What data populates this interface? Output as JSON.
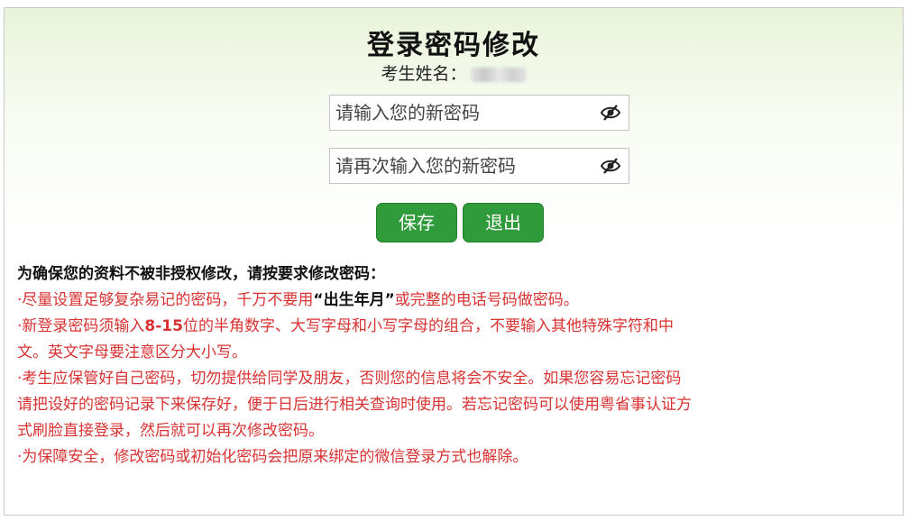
{
  "page": {
    "title": "登录密码修改",
    "name_label": "考生姓名："
  },
  "form": {
    "new_password_placeholder": "请输入您的新密码",
    "confirm_password_placeholder": "请再次输入您的新密码",
    "save_label": "保存",
    "exit_label": "退出"
  },
  "notice": {
    "heading": "为确保您的资料不被非授权修改，请按要求修改密码：",
    "item1_a": "·尽量设置足够复杂易记的密码，千万不要用",
    "item1_b": "“出生年月”",
    "item1_c": "或完整的电话号码做密码。",
    "item2_a": "·新登录密码须输入",
    "item2_b": "8-15",
    "item2_c": "位的半角数字、大写字母和小写字母的组合，不要输入其他特殊字符和中",
    "item2_d": "文。英文字母要注意区分大小写。",
    "item3_a": "·考生应保管好自己密码，切勿提供给同学及朋友，否则您的信息将会不安全。如果您容易忘记密码",
    "item3_b": "请把设好的密码记录下来保存好，便于日后进行相关查询时使用。若忘记密码可以使用粤省事认证方",
    "item3_c": "式刷脸直接登录，然后就可以再次修改密码。",
    "item4": "·为保障安全，修改密码或初始化密码会把原来绑定的微信登录方式也解除。"
  },
  "icons": {
    "eye": "eye-slash-icon"
  },
  "colors": {
    "button": "#2f9b3a",
    "notice_text": "#d83232"
  }
}
